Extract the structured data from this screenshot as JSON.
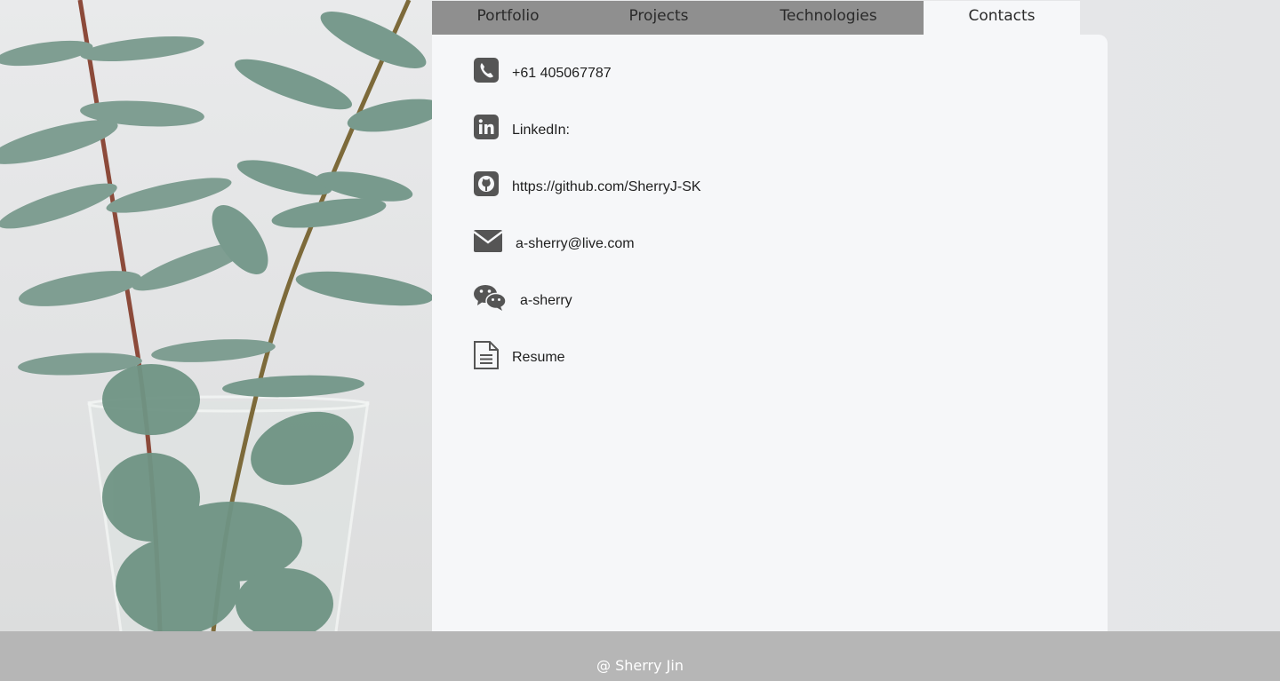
{
  "nav": {
    "tabs": [
      {
        "label": "Portfolio"
      },
      {
        "label": "Projects"
      },
      {
        "label": "Technologies"
      },
      {
        "label": "Contacts",
        "active": true
      }
    ]
  },
  "contacts": {
    "phone": {
      "icon": "phone-icon",
      "text": "+61 405067787"
    },
    "linkedin": {
      "icon": "linkedin-icon",
      "text": "LinkedIn:"
    },
    "github": {
      "icon": "github-icon",
      "text": "https://github.com/SherryJ-SK"
    },
    "email": {
      "icon": "envelope-icon",
      "text": "a-sherry@live.com"
    },
    "wechat": {
      "icon": "wechat-icon",
      "text": "a-sherry"
    },
    "resume": {
      "icon": "document-icon",
      "text": "Resume"
    }
  },
  "footer": {
    "text": "@ Sherry Jin"
  },
  "colors": {
    "tab_bar": "#8f8f8f",
    "panel": "#f6f7f9",
    "footer": "#b6b6b6",
    "icon": "#555555"
  }
}
